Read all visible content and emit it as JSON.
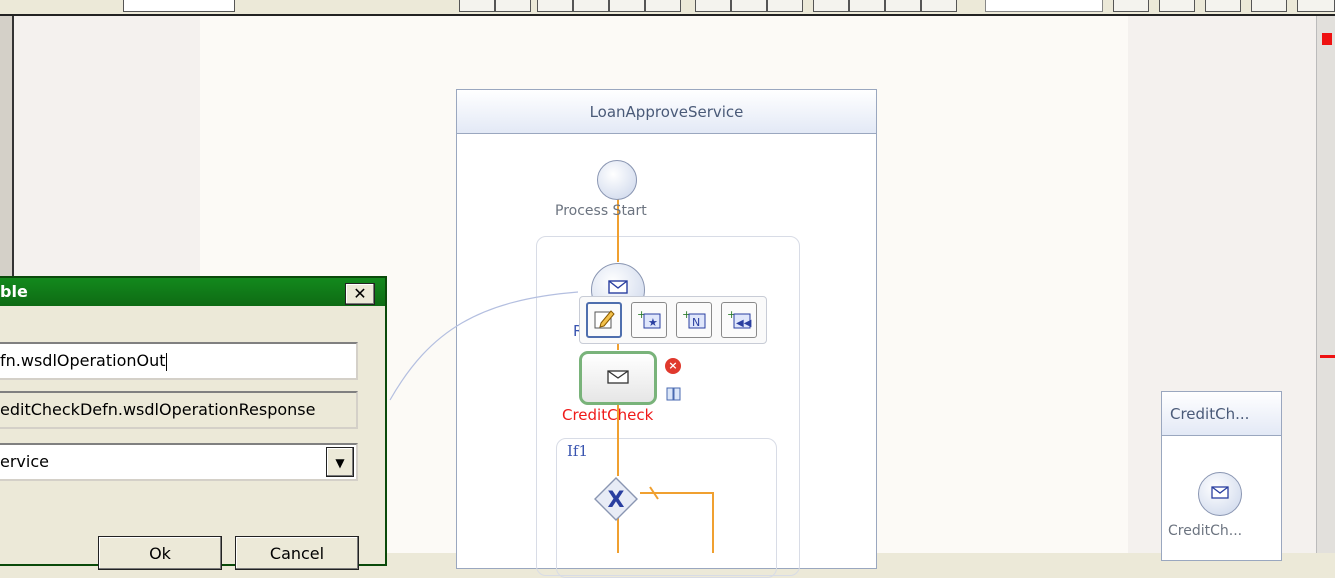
{
  "dialog": {
    "title": "ble",
    "close_glyph": "✕",
    "field_1_value": "fn.wsdlOperationOut",
    "field_2_value": "editCheckDefn.wsdlOperationResponse",
    "field_3_value": "ervice",
    "ok_label": "Ok",
    "cancel_label": "Cancel"
  },
  "diagram": {
    "pool_title": "LoanApproveService",
    "start_label": "Process Start",
    "receive_label_fragment": "R",
    "task_label": "CreditCheck",
    "if_label": "If1",
    "gateway_glyph": "X",
    "partner_pool_title": "CreditCh...",
    "partner_node_label": "CreditCh..."
  },
  "icons": [
    "edit-icon",
    "add-star-icon",
    "add-n-icon",
    "add-rewind-icon",
    "envelope-icon",
    "error-icon",
    "book-icon",
    "dropdown-arrow-icon",
    "close-icon"
  ],
  "colors": {
    "dialog_title_bar": "#13891d",
    "task_border": "#79b37a",
    "task_label": "#ef1a1a",
    "flow_line": "#f0a030",
    "if_label": "#3a55b0",
    "pool_header": "#e3e9f6"
  }
}
